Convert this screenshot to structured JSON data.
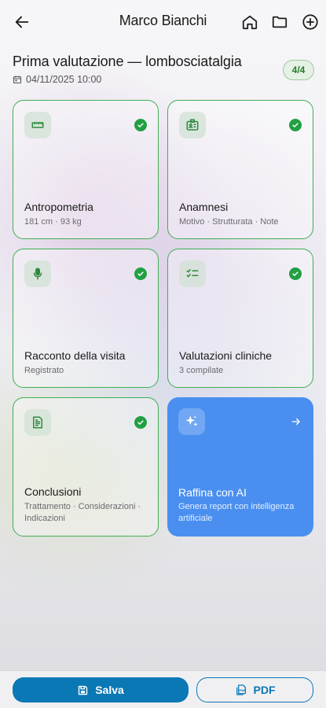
{
  "header": {
    "title": "Marco Bianchi",
    "icons": [
      "arrow-left-icon",
      "home-icon",
      "folder-icon",
      "plus-circle-icon"
    ]
  },
  "evaluation": {
    "title": "Prima valutazione — lombosciatalgia",
    "date": "04/11/2025 10:00",
    "progress": "4/4"
  },
  "cards": [
    {
      "title": "Antropometria",
      "subtitle": "181 cm · 93 kg",
      "icon": "ruler-icon",
      "completed": true
    },
    {
      "title": "Anamnesi",
      "subtitle": "Motivo · Strutturata · Note",
      "icon": "id-card-icon",
      "completed": true
    },
    {
      "title": "Racconto della visita",
      "subtitle": "Registrato",
      "icon": "microphone-icon",
      "completed": true
    },
    {
      "title": "Valutazioni cliniche",
      "subtitle": "3 compilate",
      "icon": "checklist-icon",
      "completed": true
    },
    {
      "title": "Conclusioni",
      "subtitle": "Trattamento · Considerazioni · Indicazioni",
      "icon": "document-icon",
      "completed": true
    },
    {
      "title": "Raffina con AI",
      "subtitle": "Genera report con intelligenza artificiale",
      "icon": "sparkles-icon",
      "completed": false
    }
  ],
  "actions": {
    "save_label": "Salva",
    "pdf_label": "PDF"
  },
  "colors": {
    "accent": "#0a78b4",
    "complete_green": "#22a043",
    "ai_card": "#4a8ff0"
  }
}
